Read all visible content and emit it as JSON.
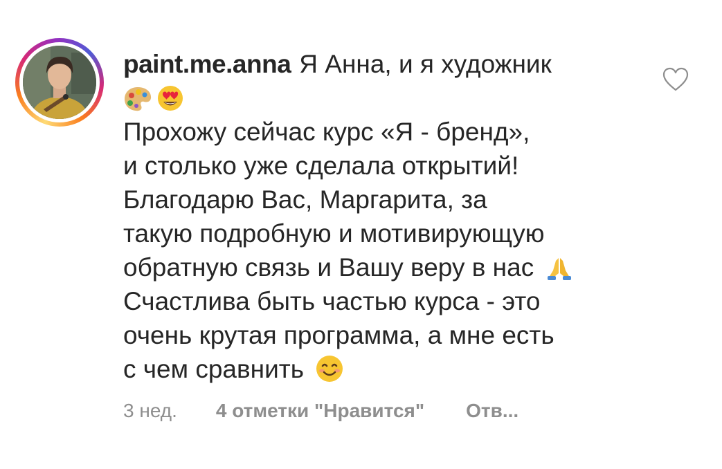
{
  "comment": {
    "username": "paint.me.anna",
    "first_line_text": "Я Анна, и я художник",
    "lines": [
      "Прохожу сейчас курс «Я - бренд»,",
      "и столько уже сделала открытий!",
      "Благодарю Вас, Маргарита, за",
      "такую подробную и мотивирующую",
      "обратную связь и Вашу веру в нас",
      "Счастлива быть частью  курса - это",
      "очень крутая программа, а мне есть",
      "с чем сравнить"
    ],
    "emojis": [
      "artist-palette",
      "heart-eyes-face",
      "folded-hands",
      "smiling-face-blush"
    ]
  },
  "meta": {
    "time": "3 нед.",
    "likes": "4 отметки \"Нравится\"",
    "reply": "Отв..."
  },
  "icons": {
    "like": "heart-outline-icon"
  },
  "colors": {
    "text": "#262626",
    "secondary": "#8e8e8e",
    "ring_gradient": [
      "#feda75",
      "#fa7e1e",
      "#d62976",
      "#962fbf",
      "#4f5bd5"
    ]
  }
}
